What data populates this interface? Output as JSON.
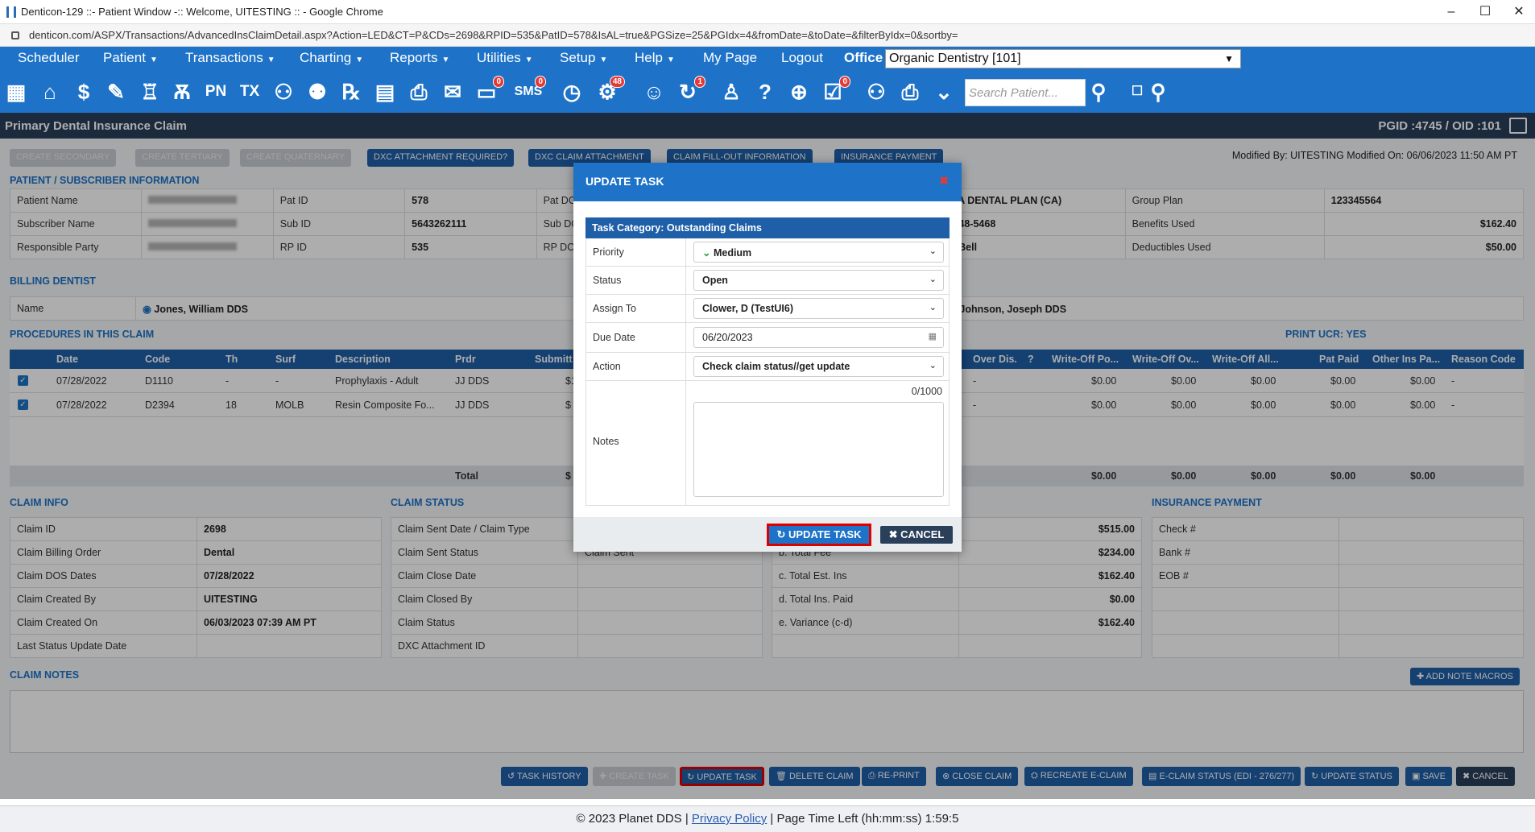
{
  "window": {
    "title": "Denticon-129 ::- Patient Window -:: Welcome, UITESTING :: - Google Chrome",
    "url": "denticon.com/ASPX/Transactions/AdvancedInsClaimDetail.aspx?Action=LED&CT=P&CDs=2698&RPID=535&PatID=578&IsAL=true&PGSize=25&PGIdx=4&fromDate=&toDate=&filterByIdx=0&sortby="
  },
  "menu": [
    "Scheduler",
    "Patient",
    "Transactions",
    "Charting",
    "Reports",
    "Utilities",
    "Setup",
    "Help",
    "My Page",
    "Logout"
  ],
  "office": {
    "label": "Office",
    "value": "Organic Dentistry [101]"
  },
  "toolbar": {
    "search_placeholder": "Search Patient...",
    "badges": {
      "sms": "0",
      "alerts": "48",
      "reminder": "1",
      "claims": "0"
    }
  },
  "page": {
    "title": "Primary Dental Insurance Claim",
    "ids": "PGID :4745  /  OID :101"
  },
  "top_buttons": [
    "CREATE SECONDARY",
    "CREATE TERTIARY",
    "CREATE QUATERNARY",
    "DXC ATTACHMENT REQUIRED?",
    "DXC CLAIM ATTACHMENT",
    "CLAIM FILL-OUT INFORMATION",
    "INSURANCE PAYMENT"
  ],
  "modified": "Modified By:  UITESTING  Modified On:  06/06/2023 11:50 AM PT",
  "sections": {
    "patient": "PATIENT / SUBSCRIBER INFORMATION",
    "billing": "BILLING DENTIST",
    "procedures": "PROCEDURES IN THIS CLAIM",
    "print_ucr": "PRINT UCR: YES",
    "claim_info": "CLAIM INFO",
    "claim_status": "CLAIM STATUS",
    "ins_payment": "INSURANCE PAYMENT",
    "claim_notes": "CLAIM NOTES"
  },
  "patient": {
    "labels": [
      "Patient Name",
      "Subscriber Name",
      "Responsible Party"
    ],
    "id_labels": [
      "Pat ID",
      "Sub ID",
      "RP ID"
    ],
    "ids": [
      "578",
      "5643262111",
      "535"
    ],
    "dob_labels": [
      "Pat DOB",
      "Sub DOB",
      "RP DOB"
    ],
    "plan": [
      "DELTA DENTAL PLAN (CA)",
      "800-548-5468",
      "Taco Bell"
    ],
    "right_labels": [
      "Group Plan",
      "Benefits Used",
      "Deductibles Used"
    ],
    "right_values": [
      "123345564",
      "$162.40",
      "$50.00"
    ]
  },
  "billing": {
    "label": "Name",
    "dentist": "Jones, William DDS",
    "dentist2": "Johnson, Joseph DDS"
  },
  "procedures": {
    "headers": [
      "Date",
      "Code",
      "Th",
      "Surf",
      "Description",
      "Prdr",
      "Submitt",
      "Over Dis.",
      "Write-Off Po...",
      "Write-Off Ov...",
      "Write-Off All...",
      "Pat Paid",
      "Other Ins Pa...",
      "Reason Code"
    ],
    "rows": [
      {
        "date": "07/28/2022",
        "code": "D1110",
        "th": "-",
        "surf": "-",
        "desc": "Prophylaxis - Adult",
        "prdr": "JJ DDS",
        "sub": "$1",
        "over": "-",
        "w1": "$0.00",
        "w2": "$0.00",
        "w3": "$0.00",
        "pat": "$0.00",
        "oth": "$0.00",
        "reason": "-"
      },
      {
        "date": "07/28/2022",
        "code": "D2394",
        "th": "18",
        "surf": "MOLB",
        "desc": "Resin Composite Fo...",
        "prdr": "JJ DDS",
        "sub": "$",
        "over": "-",
        "w1": "$0.00",
        "w2": "$0.00",
        "w3": "$0.00",
        "pat": "$0.00",
        "oth": "$0.00",
        "reason": "-"
      }
    ],
    "total_label": "Total",
    "total_sub": "$",
    "totals": [
      "$0.00",
      "$0.00",
      "$0.00",
      "$0.00",
      "$0.00"
    ]
  },
  "claim_info": {
    "labels": [
      "Claim ID",
      "Claim Billing Order",
      "Claim DOS Dates",
      "Claim Created By",
      "Claim Created On",
      "Last Status Update Date"
    ],
    "values": [
      "2698",
      "Dental",
      "07/28/2022",
      "UITESTING",
      "06/03/2023 07:39 AM PT",
      ""
    ]
  },
  "claim_status": {
    "labels": [
      "Claim Sent Date / Claim Type",
      "Claim Sent Status",
      "Claim Close Date",
      "Claim Closed By",
      "Claim Status",
      "DXC Attachment ID"
    ],
    "sent_status": "Claim Sent"
  },
  "amounts": {
    "labels": [
      "b. Total Fee",
      "c. Total Est. Ins",
      "d. Total Ins. Paid",
      "e. Variance (c-d)"
    ],
    "values": [
      "$515.00",
      "$234.00",
      "$162.40",
      "$0.00",
      "$162.40"
    ]
  },
  "ins_payment": [
    "Check #",
    "Bank #",
    "EOB #"
  ],
  "add_note_macros": "ADD NOTE MACROS",
  "bottom_buttons": [
    "TASK HISTORY",
    "CREATE TASK",
    "UPDATE TASK",
    "DELETE CLAIM",
    "RE-PRINT",
    "CLOSE CLAIM",
    "RECREATE E-CLAIM",
    "E-CLAIM STATUS (EDI - 276/277)",
    "UPDATE STATUS",
    "SAVE",
    "CANCEL"
  ],
  "footer": {
    "copy": "© 2023 Planet DDS | ",
    "link": "Privacy Policy",
    "rest": " |  Page Time Left (hh:mm:ss) 1:59:5"
  },
  "modal": {
    "title": "UPDATE TASK",
    "category": "Task Category: Outstanding Claims",
    "priority_label": "Priority",
    "priority": "Medium",
    "status_label": "Status",
    "status": "Open",
    "assign_label": "Assign To",
    "assign": "Clower, D (TestUI6)",
    "due_label": "Due Date",
    "due": "06/20/2023",
    "action_label": "Action",
    "action": "Check claim status//get update",
    "notes_label": "Notes",
    "notes_count": "0/1000",
    "notes": "",
    "update_btn": "UPDATE TASK",
    "cancel_btn": "CANCEL"
  },
  "colors": {
    "primary": "#1e73c8",
    "dark": "#2a3f5a",
    "highlight": "#dd0000"
  }
}
